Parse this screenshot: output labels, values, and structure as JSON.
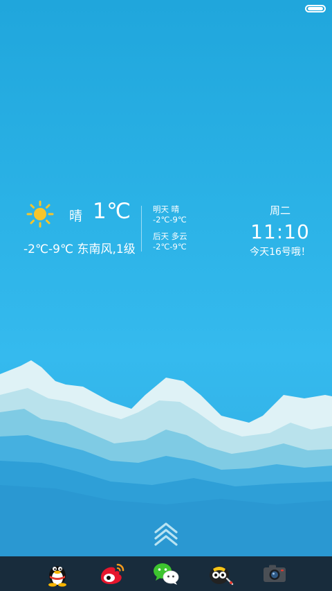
{
  "weather": {
    "condition": "晴",
    "current_temp": "1℃",
    "range_wind": "-2℃-9℃ 东南风,1级",
    "forecast": [
      {
        "day_condition": "明天 晴",
        "range": "-2℃-9℃"
      },
      {
        "day_condition": "后天 多云",
        "range": "-2℃-9℃"
      }
    ]
  },
  "clock": {
    "weekday": "周二",
    "time": "11:10",
    "date_message": "今天16号哦！"
  },
  "dock": {
    "apps": [
      "qq-icon",
      "weibo-icon",
      "wechat-icon",
      "bee-app-icon",
      "camera-icon"
    ]
  },
  "colors": {
    "sky_top": "#20a6dc",
    "dock_bg": "#182c3c",
    "sun": "#f7c52b"
  }
}
